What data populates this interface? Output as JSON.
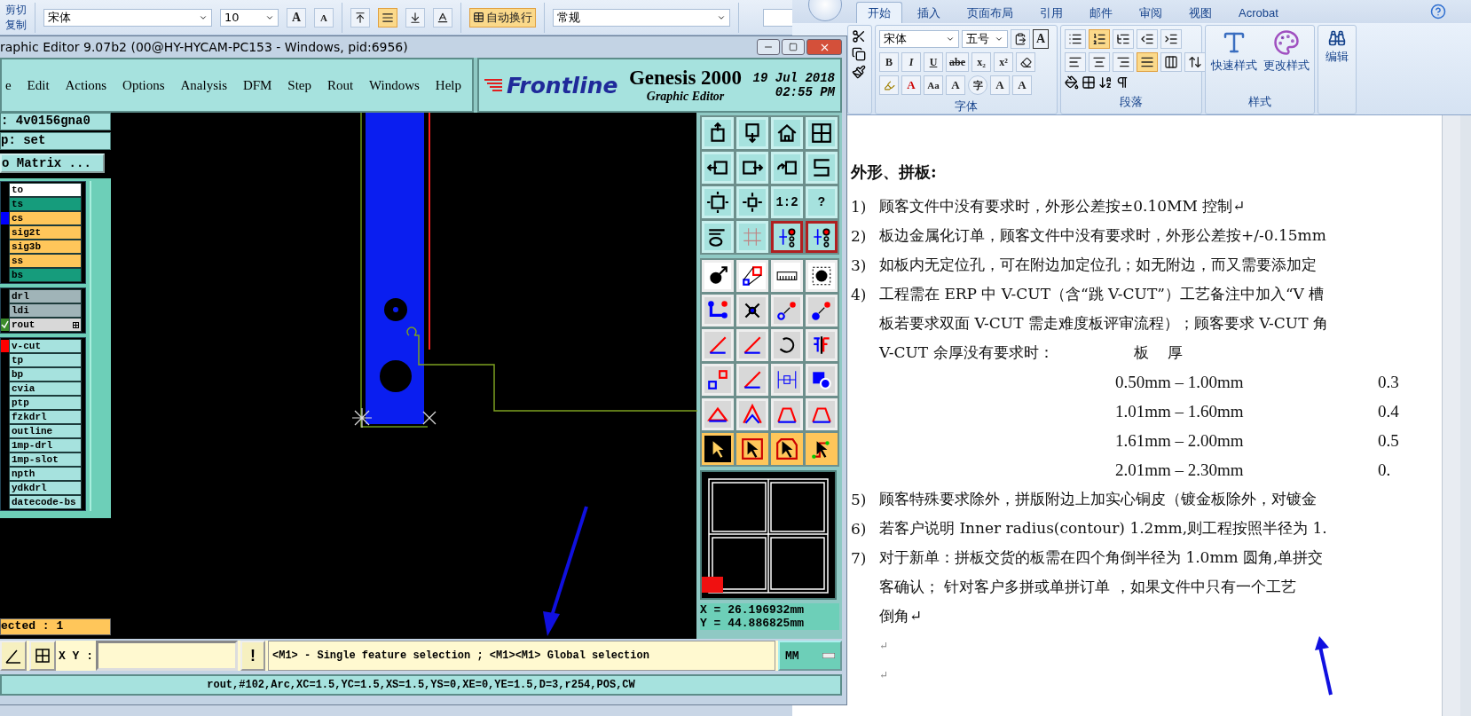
{
  "excel": {
    "clipboard": [
      "剪切",
      "复制"
    ],
    "font": "宋体",
    "size": "10",
    "grow_font": "A",
    "shrink_font": "A",
    "align_buttons": [
      {
        "on": false
      },
      {
        "on": true
      },
      {
        "on": false
      }
    ],
    "wrap_text": {
      "label": "自动换行",
      "on": true
    },
    "number_format": "常规"
  },
  "word": {
    "tabs": [
      {
        "label": "开始",
        "selected": true
      },
      {
        "label": "插入",
        "selected": false
      },
      {
        "label": "页面布局",
        "selected": false
      },
      {
        "label": "引用",
        "selected": false
      },
      {
        "label": "邮件",
        "selected": false
      },
      {
        "label": "审阅",
        "selected": false
      },
      {
        "label": "视图",
        "selected": false
      },
      {
        "label": "Acrobat",
        "selected": false
      }
    ],
    "font": "宋体",
    "font_size": "五号",
    "border_char": "A",
    "format_buttons": [
      "B",
      "I",
      "U",
      "abe",
      "x₂",
      "x²"
    ],
    "effect_buttons": [
      "A",
      "Aa",
      "A",
      "字",
      "A",
      "A"
    ],
    "paragraph_buttons": [
      {
        "on": false
      },
      {
        "on": true
      },
      {
        "on": false
      },
      {
        "on": false
      },
      {
        "on": false
      },
      {
        "on": false
      },
      {
        "on": false
      },
      {
        "on": false
      },
      {
        "on": true
      },
      {
        "on": false
      },
      {
        "on": false
      }
    ],
    "groups": [
      "字体",
      "段落",
      "样式"
    ],
    "styles": [
      "快速样式",
      "更改样式"
    ],
    "editing": "编辑",
    "document": {
      "heading": "外形、拼板:",
      "lines": [
        {
          "kind": "numbered",
          "number": "1)",
          "text": "顾客文件中没有要求时，外形公差按±0.10MM 控制↵"
        },
        {
          "kind": "numbered",
          "number": "2)",
          "text": "板边金属化订单，顾客文件中没有要求时，外形公差按+/-0.15mm"
        },
        {
          "kind": "numbered",
          "number": "3)",
          "text": "如板内无定位孔，可在附边加定位孔；如无附边，而又需要添加定"
        },
        {
          "kind": "numbered",
          "number": "4)",
          "text": "工程需在 ERP 中 V-CUT（含“跳 V-CUT”）工艺备注中加入“V 槽"
        },
        {
          "kind": "continued",
          "text": "板若要求双面 V-CUT 需走难度板评审流程）；顾客要求 V-CUT 角"
        },
        {
          "kind": "header",
          "text": "V-CUT 余厚没有要求时：",
          "header": "板　厚"
        },
        {
          "kind": "table",
          "range": "0.50mm – 1.00mm",
          "value": "0.3"
        },
        {
          "kind": "table",
          "range": "1.01mm – 1.60mm",
          "value": "0.4"
        },
        {
          "kind": "table",
          "range": "1.61mm – 2.00mm",
          "value": "0.5"
        },
        {
          "kind": "table",
          "range": "2.01mm – 2.30mm",
          "value": "0."
        },
        {
          "kind": "numbered",
          "number": "5)",
          "text": "顾客特殊要求除外，拼版附边上加实心铜皮（镀金板除外，对镀金"
        },
        {
          "kind": "numbered",
          "number": "6)",
          "text": "若客户说明 Inner radius(contour) 1.2mm,则工程按照半径为 1."
        },
        {
          "kind": "numbered",
          "number": "7)",
          "text": "对于新单：拼板交货的板需在四个角倒半径为 1.0mm 圆角,单拼交"
        },
        {
          "kind": "continued",
          "text": "客确认； 针对客户多拼或单拼订单 ，如果文件中只有一个工艺"
        },
        {
          "kind": "continued",
          "text": "倒角↵"
        },
        {
          "kind": "mark",
          "text": "↵"
        },
        {
          "kind": "mark",
          "text": "↵"
        }
      ]
    }
  },
  "genesis": {
    "title": "raphic Editor 9.07b2 (00@HY-HYCAM-PC153 - Windows, pid:6956)",
    "menu": [
      "e",
      "Edit",
      "Actions",
      "Options",
      "Analysis",
      "DFM",
      "Step",
      "Rout",
      "Windows",
      "Help"
    ],
    "brand": {
      "logo": "Frontline",
      "product": "Genesis 2000",
      "subtitle": "Graphic Editor",
      "date": "19 Jul 2018",
      "time": "02:55 PM"
    },
    "job": ": 4v0156gna0",
    "step": "p: set",
    "matrix_button": "o Matrix ...",
    "layer_groups": [
      {
        "layers": [
          {
            "name": "to",
            "color": "#ffffff",
            "work": false
          },
          {
            "name": "ts",
            "color": "#169c7c",
            "work": false
          },
          {
            "name": "cs",
            "color": "#ffc65a",
            "work": false,
            "marker": {
              "color": "#0000ff"
            }
          },
          {
            "name": "sig2t",
            "color": "#ffc65a",
            "work": false
          },
          {
            "name": "sig3b",
            "color": "#ffc65a",
            "work": false
          },
          {
            "name": "ss",
            "color": "#ffc65a",
            "work": false
          },
          {
            "name": "bs",
            "color": "#169c7c",
            "work": false
          }
        ]
      },
      {
        "layers": [
          {
            "name": "drl",
            "color": "#a0b4b8",
            "work": false
          },
          {
            "name": "ldi",
            "color": "#a0b4b8",
            "work": false
          },
          {
            "name": "rout",
            "color": "#d8d8d8",
            "work": true
          }
        ]
      },
      {
        "layers": [
          {
            "name": "v-cut",
            "color": "#a6e2de",
            "work": false,
            "marker": {
              "color": "#ff0000"
            }
          },
          {
            "name": "tp",
            "color": "#a6e2de",
            "work": false
          },
          {
            "name": "bp",
            "color": "#a6e2de",
            "work": false
          },
          {
            "name": "cvia",
            "color": "#a6e2de",
            "work": false
          },
          {
            "name": "ptp",
            "color": "#a6e2de",
            "work": false
          },
          {
            "name": "fzkdrl",
            "color": "#a6e2de",
            "work": false
          },
          {
            "name": "outline",
            "color": "#a6e2de",
            "work": false
          },
          {
            "name": "1mp-drl",
            "color": "#a6e2de",
            "work": false
          },
          {
            "name": "1mp-slot",
            "color": "#a6e2de",
            "work": false
          },
          {
            "name": "npth",
            "color": "#a6e2de",
            "work": false
          },
          {
            "name": "ydkdrl",
            "color": "#a6e2de",
            "work": false
          },
          {
            "name": "datecode-bs",
            "color": "#a6e2de",
            "work": false
          }
        ]
      }
    ],
    "selected_count": "ected : 1",
    "view_tools": [
      {
        "on": false
      },
      {
        "on": false
      },
      {
        "on": false
      },
      {
        "on": false
      },
      {
        "on": false
      },
      {
        "on": false
      },
      {
        "on": false
      },
      {
        "on": false
      },
      {
        "on": false
      },
      {
        "on": false
      },
      {
        "on": false,
        "label": "1:2"
      },
      {
        "on": false,
        "label": "?"
      },
      {
        "on": false
      },
      {
        "on": false
      },
      {
        "on": true
      },
      {
        "on": true
      }
    ],
    "select_tools": [
      {
        "selected": true
      },
      {
        "selected": false
      },
      {
        "selected": false
      },
      {
        "selected": false
      }
    ],
    "coordinates": [
      "X = 26.196932mm",
      "Y = 44.886825mm"
    ],
    "xy_label": "X Y :",
    "alert_button": "!",
    "message": "<M1> - Single feature selection ; <M1><M1> Global selection",
    "units": "MM",
    "status": "rout,#102,Arc,XC=1.5,YC=1.5,XS=1.5,YS=0,XE=0,YE=1.5,D=3,r254,POS,CW"
  }
}
